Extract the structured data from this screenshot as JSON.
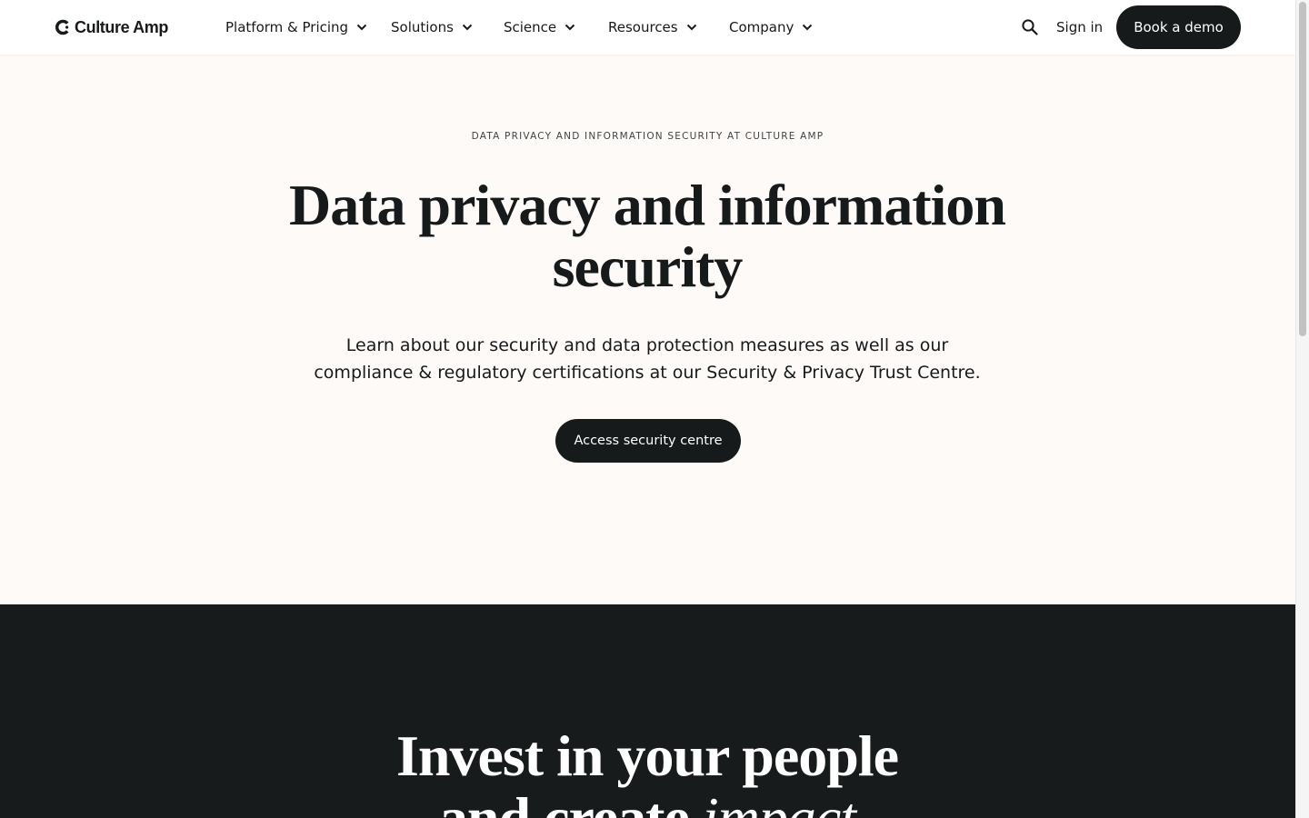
{
  "nav": {
    "logo_text": "Culture Amp",
    "items": [
      {
        "label": "Platform & Pricing"
      },
      {
        "label": "Solutions"
      },
      {
        "label": "Science"
      },
      {
        "label": "Resources"
      },
      {
        "label": "Company"
      }
    ],
    "sign_in_label": "Sign in",
    "demo_label": "Book a demo"
  },
  "hero": {
    "eyebrow": "DATA PRIVACY AND INFORMATION SECURITY AT CULTURE AMP",
    "title": "Data privacy and information security",
    "subtitle": "Learn about our security and data protection measures as well as our compliance & regulatory certifications at our Security & Privacy Trust Centre.",
    "cta_label": "Access security centre"
  },
  "promo": {
    "line1": "Invest in your people",
    "line2_prefix": "and create ",
    "line2_accent": "impact"
  },
  "icons": {
    "logo": "culture-amp-logo-icon",
    "dropdown": "chevron-down-icon",
    "search": "search-icon"
  },
  "colors": {
    "primary_dark": "#161a1b",
    "hero_bg": "#fdfaf7",
    "dark_section_bg": "#171b1c",
    "text_on_dark": "#ffffff"
  }
}
